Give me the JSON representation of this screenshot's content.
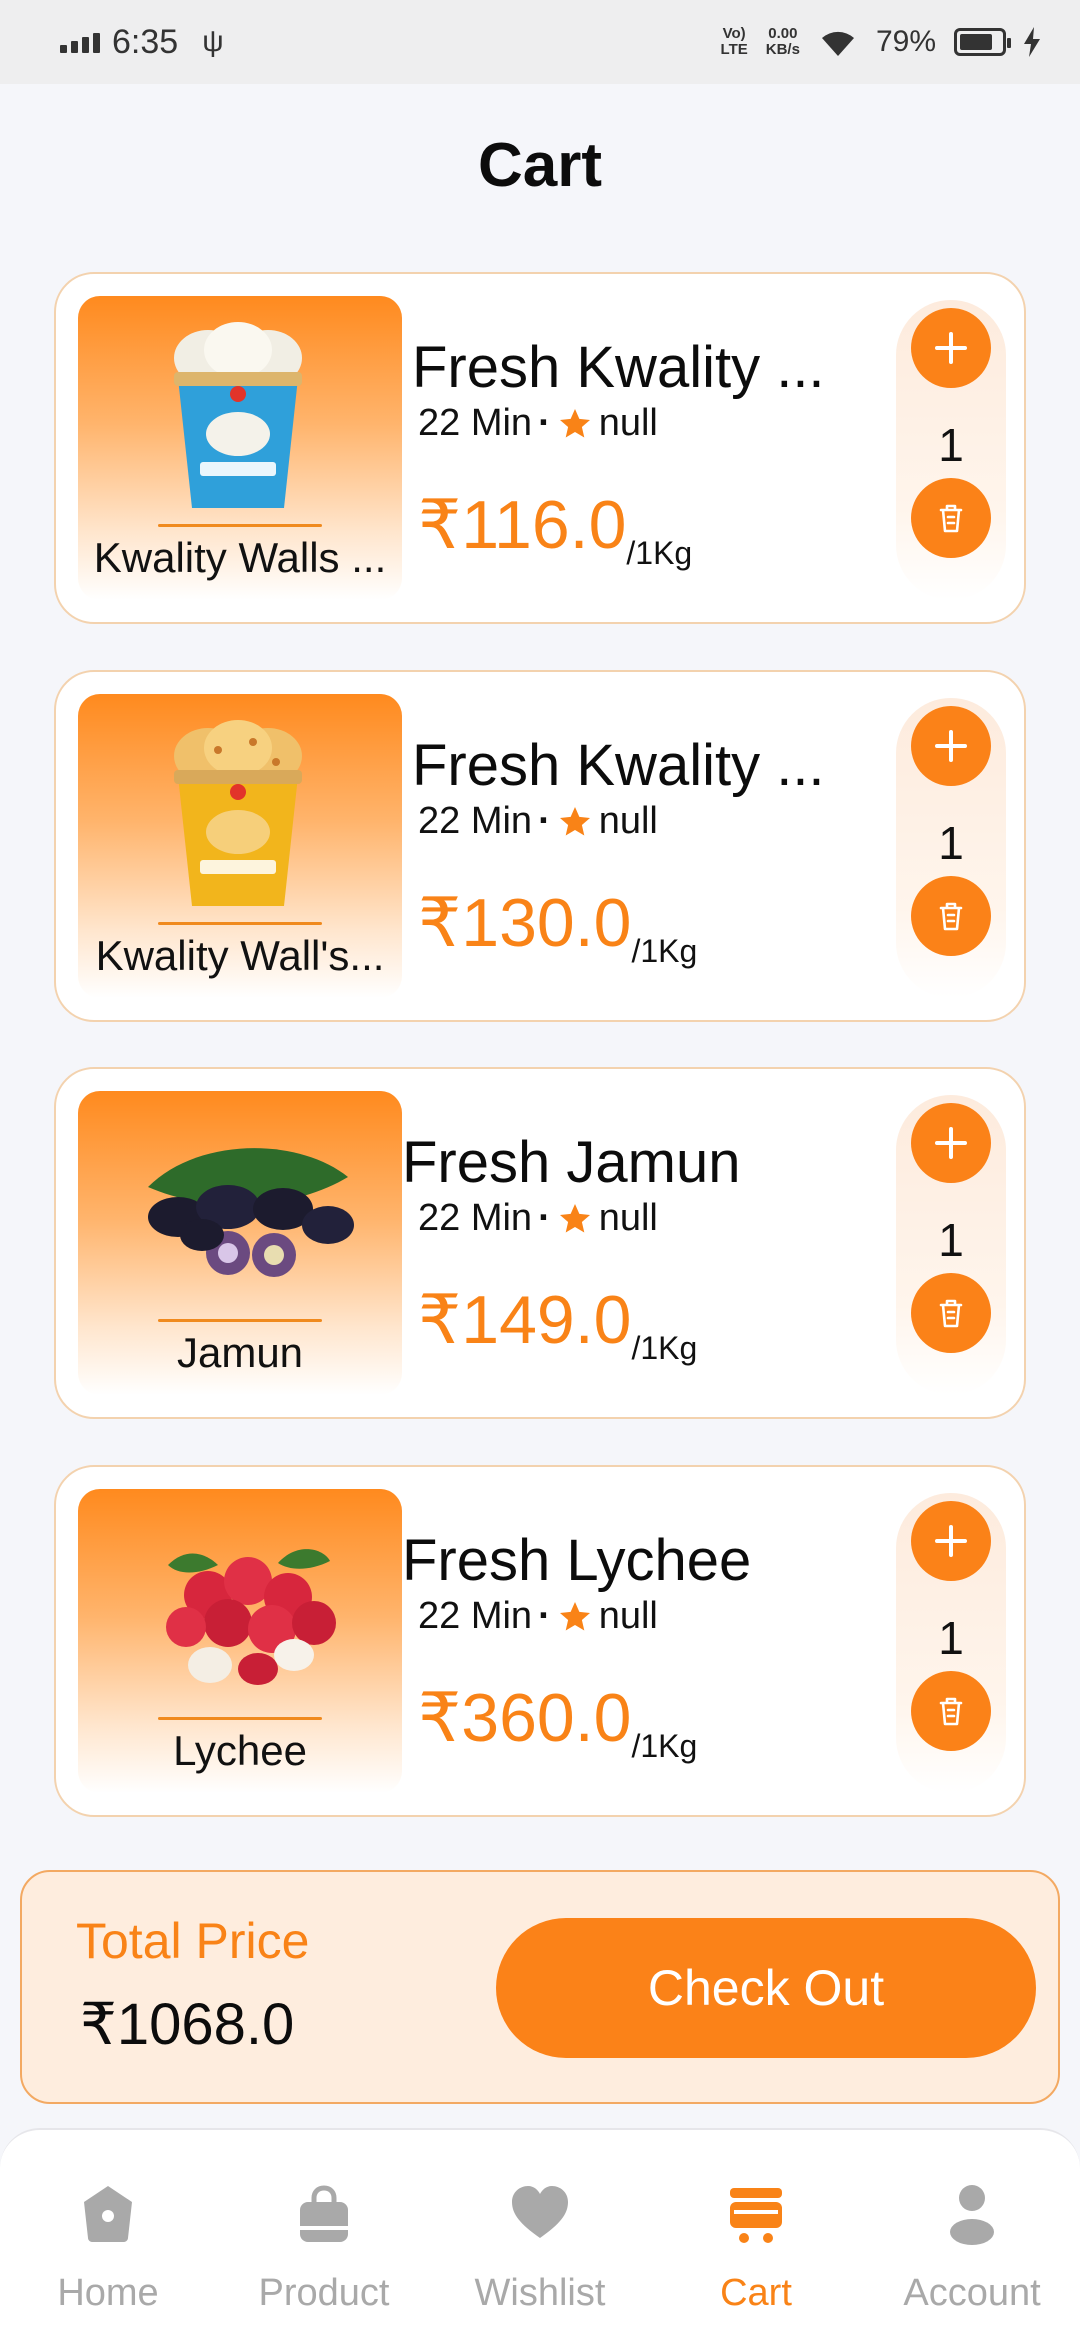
{
  "status_bar": {
    "time": "6:35",
    "network": "LTE",
    "speed": "0.00",
    "speed_unit": "KB/s",
    "battery": "79%"
  },
  "page": {
    "title": "Cart"
  },
  "colors": {
    "accent": "#F98317",
    "button": "#FB8218",
    "card_border": "#F3D2AE",
    "total_bg": "#FEEDDE"
  },
  "cart": {
    "items": [
      {
        "image_label": "Kwality Walls ...",
        "name": "Fresh Kwality ...",
        "time": "22 Min",
        "rating": "null",
        "price": "₹116.0",
        "unit": "/1Kg",
        "qty": "1",
        "image": "ice-cream-vanilla"
      },
      {
        "image_label": "Kwality Wall's...",
        "name": "Fresh Kwality ...",
        "time": "22 Min",
        "rating": "null",
        "price": "₹130.0",
        "unit": "/1Kg",
        "qty": "1",
        "image": "ice-cream-butterscotch"
      },
      {
        "image_label": "Jamun",
        "name": "Fresh Jamun",
        "time": "22 Min",
        "rating": "null",
        "price": "₹149.0",
        "unit": "/1Kg",
        "qty": "1",
        "image": "jamun-fruit"
      },
      {
        "image_label": "Lychee",
        "name": "Fresh Lychee",
        "time": "22 Min",
        "rating": "null",
        "price": "₹360.0",
        "unit": "/1Kg",
        "qty": "1",
        "image": "lychee-fruit"
      }
    ]
  },
  "total": {
    "label": "Total Price",
    "value": "₹1068.0",
    "checkout_label": "Check Out"
  },
  "nav": {
    "items": [
      {
        "label": "Home",
        "icon": "home-icon"
      },
      {
        "label": "Product",
        "icon": "bag-icon"
      },
      {
        "label": "Wishlist",
        "icon": "heart-icon"
      },
      {
        "label": "Cart",
        "icon": "cart-icon",
        "active": true
      },
      {
        "label": "Account",
        "icon": "user-icon"
      }
    ]
  }
}
